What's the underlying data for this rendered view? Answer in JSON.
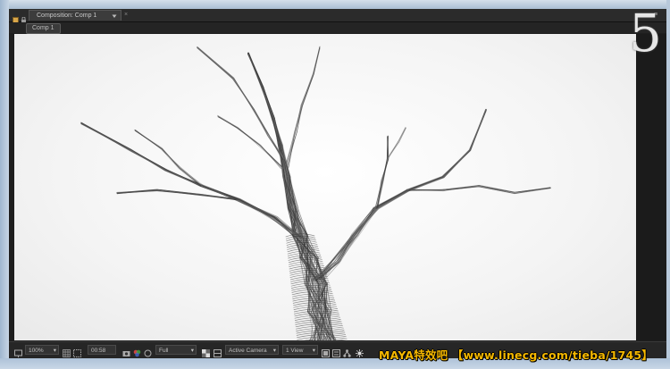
{
  "panel": {
    "tab_label": "Composition: Comp 1",
    "tab_close": "×",
    "menu_glyph": "≡"
  },
  "viewer": {
    "comp_button": "Comp 1",
    "background": "#ffffff"
  },
  "overlay": {
    "numeral": "5"
  },
  "toolbar": {
    "zoom": "100%",
    "timecode": "00:58",
    "resolution": "Full",
    "camera": "Active Camera",
    "view": "1 View"
  },
  "watermark": {
    "text": "MAYA特效吧 【www.linecg.com/tieba/1745】",
    "color": "#f5b800"
  },
  "icons": [
    "composition-icon",
    "lock-icon",
    "dropdown-icon",
    "close-icon",
    "panel-menu-icon",
    "monitor-icon",
    "grid-icon",
    "mask-icon",
    "camera-icon",
    "color-icon",
    "region-icon",
    "transparency-icon",
    "layout-icon",
    "flowchart-icon",
    "exposure-icon"
  ]
}
